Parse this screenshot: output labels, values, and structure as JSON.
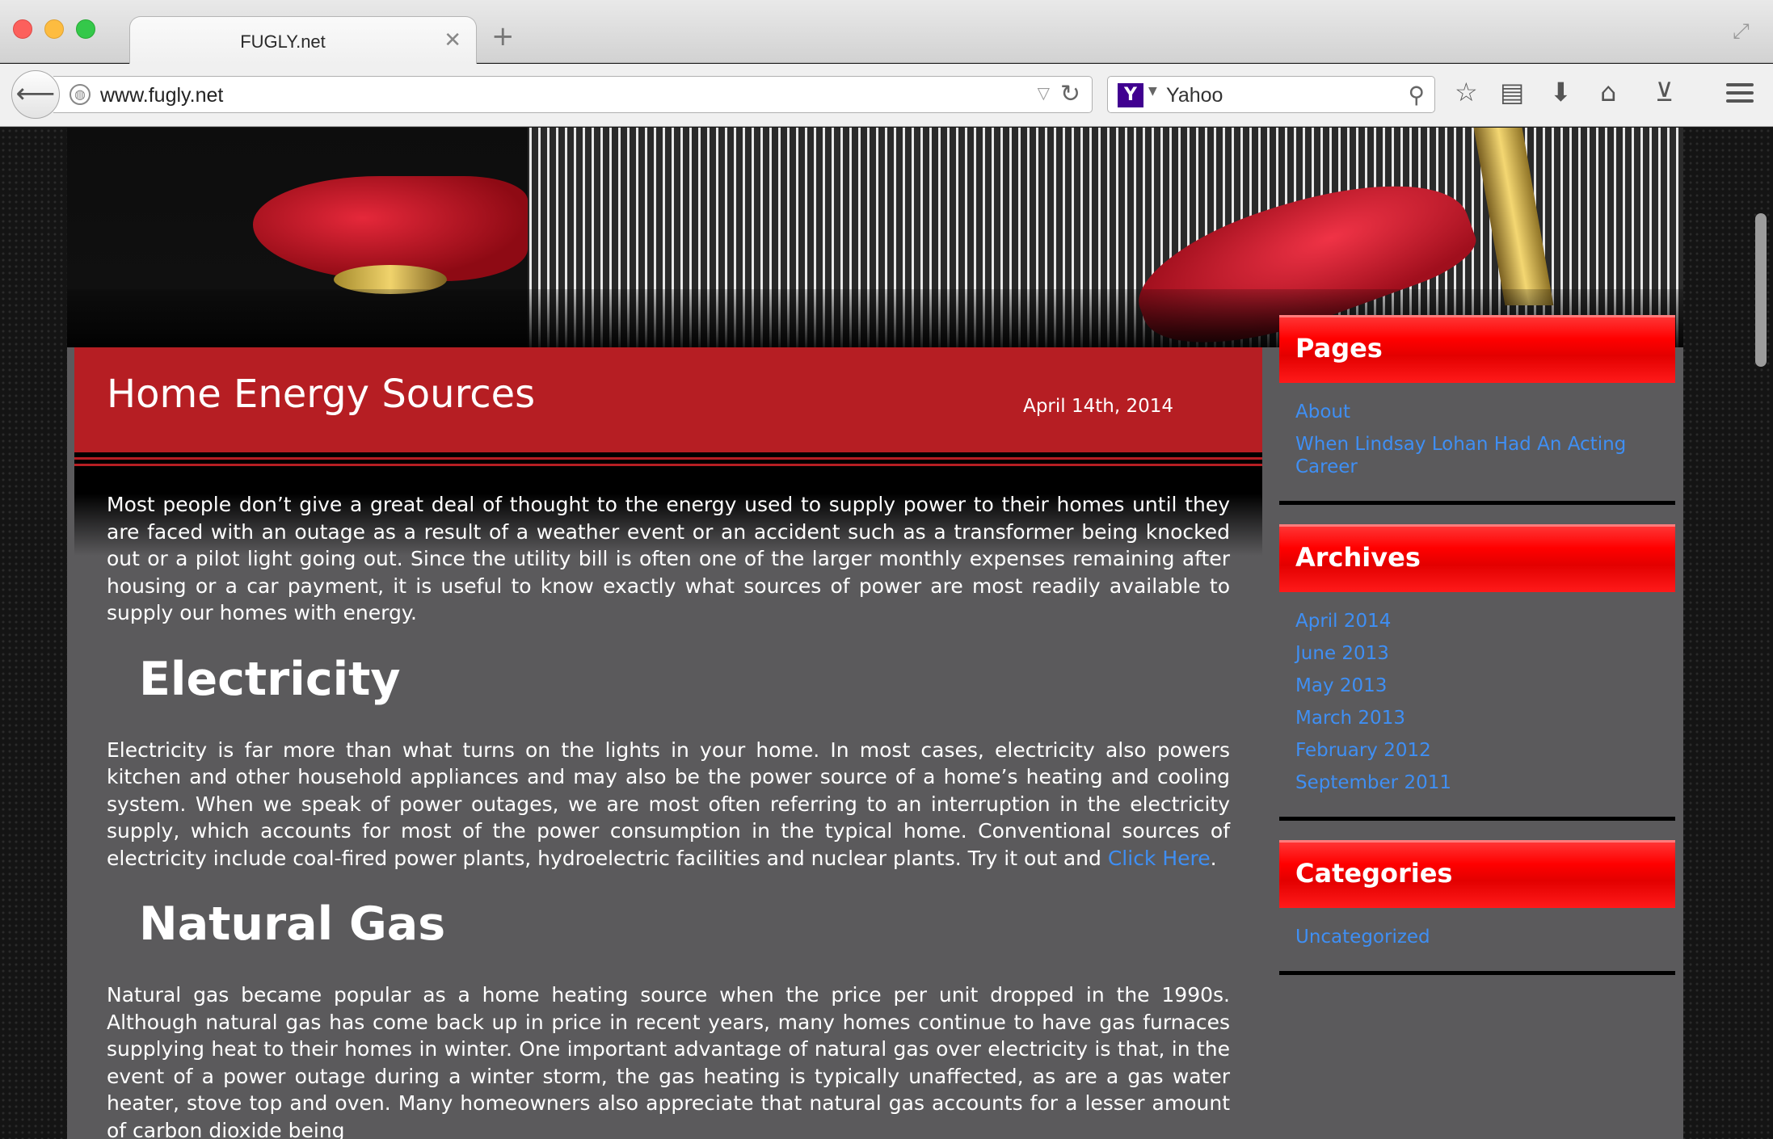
{
  "browser": {
    "tab_title": "FUGLY.net",
    "url": "www.fugly.net",
    "search_engine": "Yahoo",
    "accent": "#b61e23"
  },
  "post": {
    "title": "Home Energy Sources",
    "date": "April 14th, 2014",
    "intro": "Most people don’t give a great deal of thought to the energy used to supply power to their homes until they are faced with an outage as a result of a weather event or an accident such as a transformer being knocked out or a pilot light going out. Since the utility bill is often one of the larger monthly expenses remaining after housing or a car payment, it is useful to know exactly what sources of power are most readily available to supply our homes with energy.",
    "h_electricity": "Electricity",
    "p_electricity": "Electricity is far more than what turns on the lights in your home. In most cases, electricity also powers kitchen and other household appliances and may also be the power source of a home’s heating and cooling system. When we speak of power outages, we are most often referring to an interruption in the electricity supply, which accounts for most of the power consumption in the typical home. Conventional sources of electricity include coal-fired power plants, hydroelectric facilities and nuclear plants. Try it out and",
    "link_click_here": "Click Here",
    "period": ".",
    "h_gas": "Natural Gas",
    "p_gas": "Natural gas became popular as a home heating source when the price per unit dropped in the 1990s. Although natural gas has come back up in price in recent years, many homes continue to have gas furnaces supplying heat to their homes in winter. One important advantage of natural gas over electricity is that, in the event of a power outage during a winter storm, the gas heating is typically unaffected, as are a gas water heater, stove top and oven. Many homeowners also appreciate that natural gas accounts for a lesser amount of carbon dioxide being"
  },
  "sidebar": {
    "pages_title": "Pages",
    "pages": [
      "About",
      "When Lindsay Lohan Had An Acting Career"
    ],
    "archives_title": "Archives",
    "archives": [
      "April 2014",
      "June 2013",
      "May 2013",
      "March 2013",
      "February 2012",
      "September 2011"
    ],
    "categories_title": "Categories",
    "categories": [
      "Uncategorized"
    ]
  }
}
